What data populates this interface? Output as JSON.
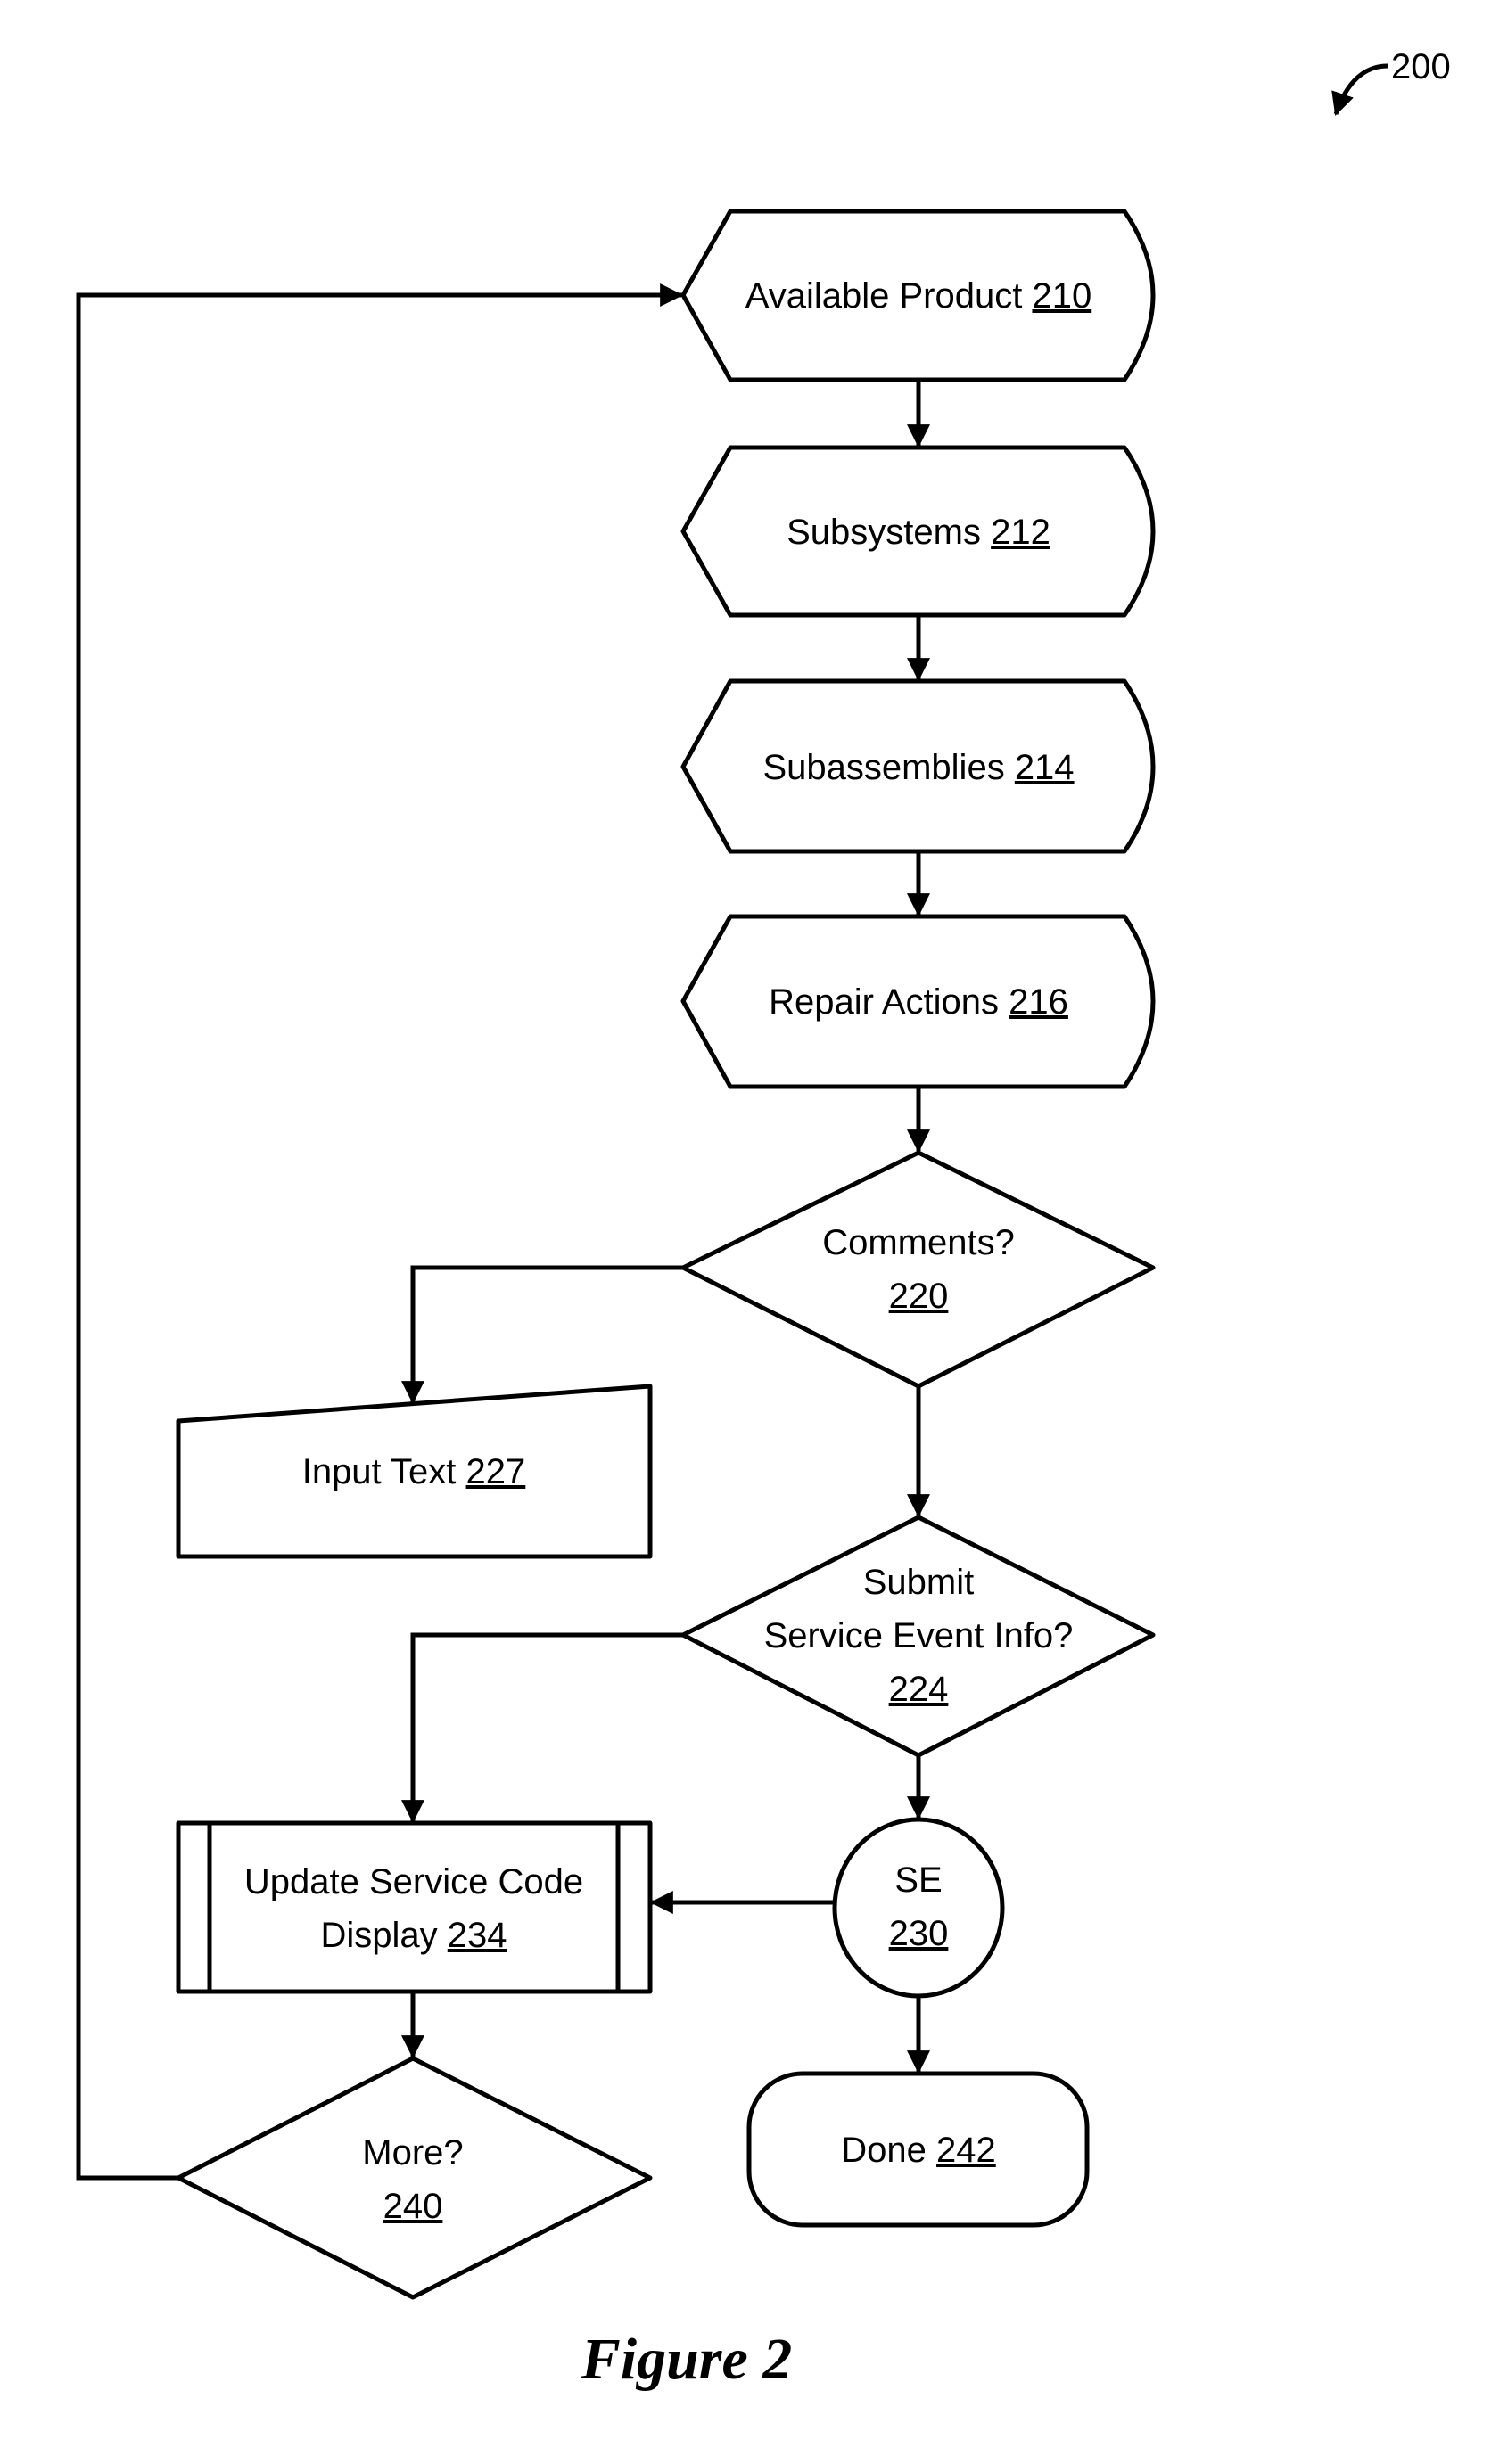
{
  "figure": {
    "caption": "Figure 2",
    "reference": "200"
  },
  "nodes": {
    "n210": {
      "text": "Available Product",
      "ref": "210",
      "type": "display"
    },
    "n212": {
      "text": "Subsystems",
      "ref": "212",
      "type": "display"
    },
    "n214": {
      "text": "Subassemblies",
      "ref": "214",
      "type": "display"
    },
    "n216": {
      "text": "Repair Actions",
      "ref": "216",
      "type": "display"
    },
    "n220": {
      "text": "Comments?",
      "ref": "220",
      "type": "decision"
    },
    "n227": {
      "text": "Input Text",
      "ref": "227",
      "type": "manual-input"
    },
    "n224": {
      "line1": "Submit",
      "line2": "Service Event Info?",
      "ref": "224",
      "type": "decision"
    },
    "n230": {
      "text": "SE",
      "ref": "230",
      "type": "connector"
    },
    "n234": {
      "line1": "Update Service Code",
      "line2": "Display",
      "ref": "234",
      "type": "predefined-process"
    },
    "n240": {
      "text": "More?",
      "ref": "240",
      "type": "decision"
    },
    "n242": {
      "text": "Done",
      "ref": "242",
      "type": "terminator"
    }
  },
  "edges": [
    {
      "from": "210",
      "to": "212"
    },
    {
      "from": "212",
      "to": "214"
    },
    {
      "from": "214",
      "to": "216"
    },
    {
      "from": "216",
      "to": "220"
    },
    {
      "from": "220",
      "to": "227"
    },
    {
      "from": "220",
      "to": "224"
    },
    {
      "from": "224",
      "to": "234"
    },
    {
      "from": "224",
      "to": "230"
    },
    {
      "from": "230",
      "to": "234"
    },
    {
      "from": "230",
      "to": "242"
    },
    {
      "from": "234",
      "to": "240"
    },
    {
      "from": "240",
      "to": "210"
    }
  ]
}
